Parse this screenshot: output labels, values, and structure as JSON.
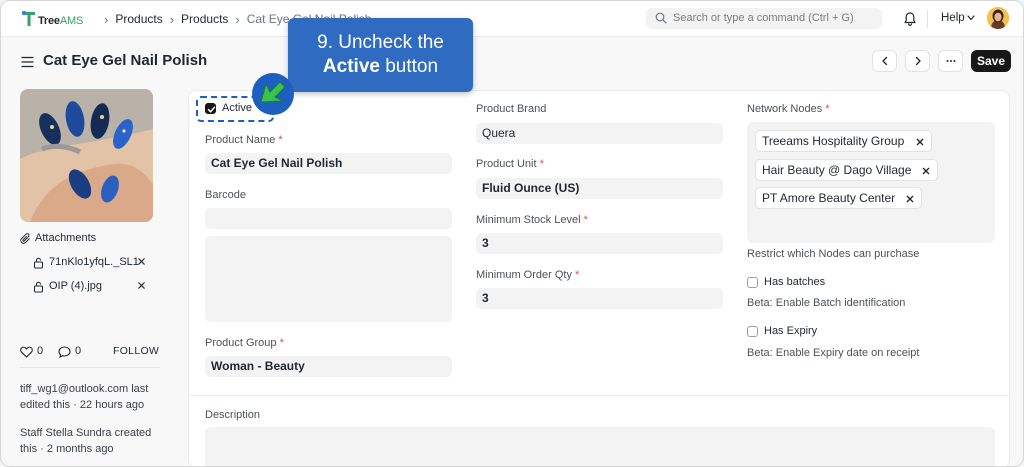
{
  "app": {
    "logo_text": "Tree",
    "logo_suffix": "AMS"
  },
  "breadcrumbs": [
    "Products",
    "Products",
    "Cat Eye Gel Nail Polish"
  ],
  "search": {
    "placeholder": "Search or type a command (Ctrl + G)"
  },
  "nav": {
    "help_label": "Help"
  },
  "page": {
    "title": "Cat Eye Gel Nail Polish",
    "save_label": "Save",
    "more_label": "···"
  },
  "sidebar": {
    "attachments_label": "Attachments",
    "attachments": [
      {
        "name": "71nKlo1yfqL._SL1"
      },
      {
        "name": "OIP (4).jpg"
      }
    ],
    "likes": "0",
    "comments": "0",
    "follow_label": "FOLLOW",
    "activity": [
      "tiff_wg1@outlook.com last edited this · 22 hours ago",
      "Staff Stella Sundra created this · 2 months ago"
    ]
  },
  "form": {
    "active_label": "Active",
    "active_checked": true,
    "product_name_label": "Product Name",
    "product_name": "Cat Eye Gel Nail Polish",
    "barcode_label": "Barcode",
    "barcode": "",
    "product_group_label": "Product Group",
    "product_group": "Woman - Beauty",
    "product_brand_label": "Product Brand",
    "product_brand": "Quera",
    "product_unit_label": "Product Unit",
    "product_unit": "Fluid Ounce (US)",
    "min_stock_label": "Minimum Stock Level",
    "min_stock": "3",
    "min_order_label": "Minimum Order Qty",
    "min_order": "3",
    "network_nodes_label": "Network Nodes",
    "network_nodes": [
      "Treeams Hospitality Group",
      "Hair Beauty @ Dago Village",
      "PT Amore Beauty Center"
    ],
    "network_nodes_help": "Restrict which Nodes can purchase",
    "has_batches_label": "Has batches",
    "has_batches_help": "Beta: Enable Batch identification",
    "has_expiry_label": "Has Expiry",
    "has_expiry_help": "Beta: Enable Expiry date on receipt",
    "description_label": "Description",
    "required_mark": "*"
  },
  "tutorial": {
    "step_line": "9. Uncheck the",
    "step_bold": "Active",
    "step_suffix": "button"
  },
  "colors": {
    "accent": "#2f6bc0",
    "pointer": "#2ea84a",
    "primary_button": "#171717",
    "required": "#e24c4c"
  }
}
